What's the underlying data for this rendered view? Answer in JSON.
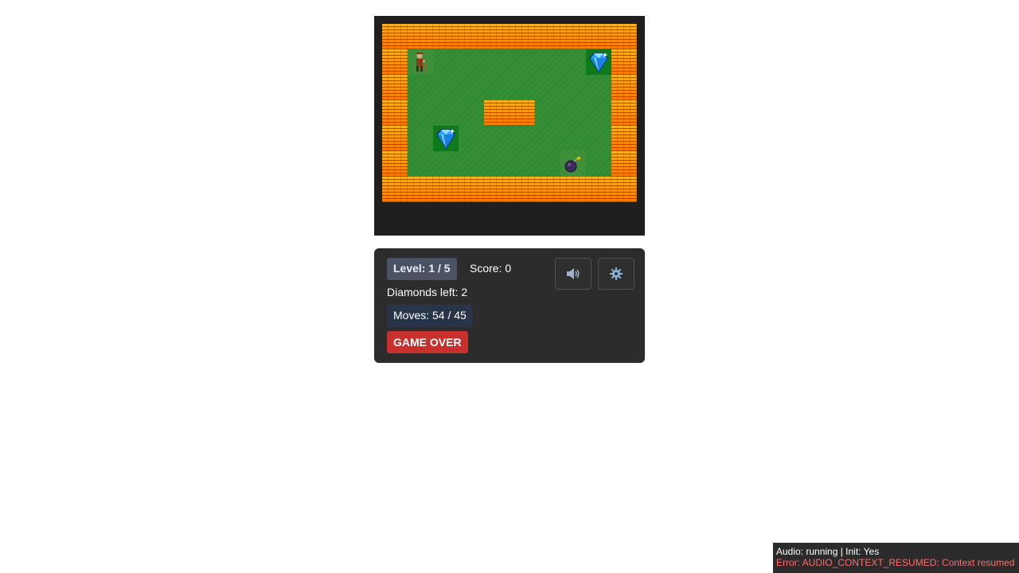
{
  "game": {
    "board": {
      "rows": [
        "##########",
        "#P......D#",
        "#........#",
        "#...##...#",
        "#.D......#",
        "#......B.#",
        "##########"
      ]
    }
  },
  "panel": {
    "level": "Level: 1 / 5",
    "score": "Score: 0",
    "diamonds": "Diamonds left: 2",
    "moves": "Moves: 54 / 45",
    "status": "GAME OVER",
    "sound_icon": "speaker-icon",
    "settings_icon": "gear-icon"
  },
  "status_bar": {
    "audio": "Audio: running | Init: Yes",
    "error": "Error: AUDIO_CONTEXT_RESUMED: Context resumed"
  },
  "colors": {
    "wall": "#ff8c00",
    "floor": "#2f8a2f",
    "panel_bg": "#2c2c2c",
    "game_over": "#c8302e",
    "error_text": "#ff6b6b"
  }
}
